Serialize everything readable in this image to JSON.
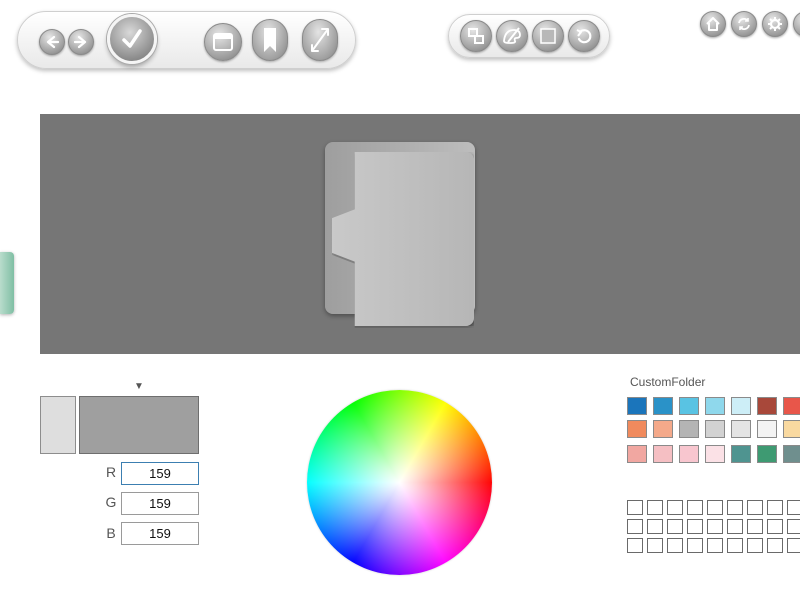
{
  "toolbar_left": {
    "buttons": [
      {
        "name": "back-button",
        "icon": "arrow-left-icon"
      },
      {
        "name": "forward-button",
        "icon": "arrow-right-icon"
      },
      {
        "name": "apply-button",
        "icon": "checkmark-icon"
      },
      {
        "name": "window-button",
        "icon": "window-icon"
      },
      {
        "name": "bookmark-button",
        "icon": "bookmark-icon"
      },
      {
        "name": "resize-button",
        "icon": "resize-icon"
      }
    ]
  },
  "toolbar_middle": {
    "buttons": [
      {
        "name": "layers-button",
        "icon": "layers-icon"
      },
      {
        "name": "paint-button",
        "icon": "paint-palette-icon"
      },
      {
        "name": "frame-button",
        "icon": "frame-icon"
      },
      {
        "name": "undo-button",
        "icon": "undo-icon"
      }
    ]
  },
  "toolbar_right": {
    "buttons": [
      {
        "name": "home-button",
        "icon": "home-icon"
      },
      {
        "name": "refresh-button",
        "icon": "refresh-icon"
      },
      {
        "name": "settings-button",
        "icon": "gear-icon"
      }
    ]
  },
  "preview": {
    "background": "#767676",
    "folder_color": "#bcbcbc"
  },
  "color_editor": {
    "old_color": "#dedede",
    "new_color": "#9f9f9f",
    "channels": [
      {
        "label": "R",
        "value": "159"
      },
      {
        "label": "G",
        "value": "159"
      },
      {
        "label": "B",
        "value": "159"
      }
    ]
  },
  "palette": {
    "title": "CustomFolder",
    "rows": [
      [
        "#1b75bb",
        "#2a92c8",
        "#59c3e3",
        "#8fd8ec",
        "#cdeef7",
        "#a8483a",
        "#e8564a",
        "#f0b24c"
      ],
      [
        "#f08a5d",
        "#f4a98a",
        "#b4b4b4",
        "#d2d2d2",
        "#e4e4e4",
        "#f3f3f3",
        "#f9d9a0",
        "#f4a56f"
      ],
      [
        "#f1a7a1",
        "#f5bfc3",
        "#f8c6cf",
        "#fbe1e6",
        "#4f9490",
        "#3e9a72",
        "#6f8f8e",
        "#9aa5a5"
      ]
    ],
    "custom_rows": 3,
    "custom_cols": 10
  }
}
